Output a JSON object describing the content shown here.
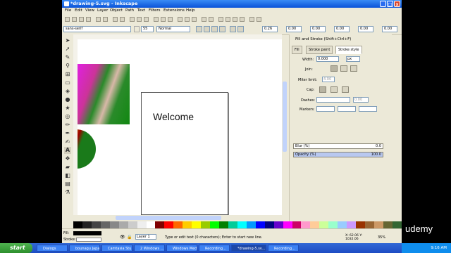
{
  "window": {
    "title": "*drawing-5.svg - Inkscape",
    "min": "_",
    "max": "□",
    "close": "x"
  },
  "menu": [
    "File",
    "Edit",
    "View",
    "Layer",
    "Object",
    "Path",
    "Text",
    "Filters",
    "Extensions",
    "Help"
  ],
  "text_toolbar": {
    "font_family": "sans-serif",
    "font_size": "55",
    "font_style": "Normal",
    "spacing": "0.26",
    "kern_x": "0.00",
    "kern_y": "0.00",
    "offset_1": "0.00",
    "offset_2": "0.00",
    "offset_3": "0.00"
  },
  "canvas": {
    "text": "Welcome"
  },
  "dock": {
    "title": "Fill and Stroke (Shift+Ctrl+F)",
    "tabs": [
      "Fill",
      "Stroke paint",
      "Stroke style"
    ],
    "width_label": "Width:",
    "width_value": "0.000",
    "width_unit": "px",
    "join_label": "Join:",
    "miter_label": "Miter limit:",
    "miter_value": "4.00",
    "cap_label": "Cap:",
    "dashes_label": "Dashes:",
    "dashes_value": "0.00",
    "markers_label": "Markers:",
    "blur_label": "Blur (%)",
    "blur_value": "0.0",
    "opacity_label": "Opacity (%)",
    "opacity_value": "100.0"
  },
  "status": {
    "fill_label": "Fill:",
    "stroke_label": "Stroke:",
    "layer": "Layer 1",
    "message": "Type or edit text (0 characters); Enter to start new line.",
    "coords": "X: 62.06  Y: 1032.06",
    "zoom": "35%"
  },
  "taskbar": {
    "start": "start",
    "tasks": [
      "Dialogs",
      "bounagu Japa...",
      "Camtasia Stu...",
      "2 Windows ...",
      "Windows Medi...",
      "Recording...",
      "*drawing-5.sv...",
      "Recording..."
    ],
    "clock": "9:16 AM"
  },
  "watermark": "udemy",
  "colors": {
    "xp_blue": "#1d4cc4",
    "start_green": "#2d8f2d"
  }
}
